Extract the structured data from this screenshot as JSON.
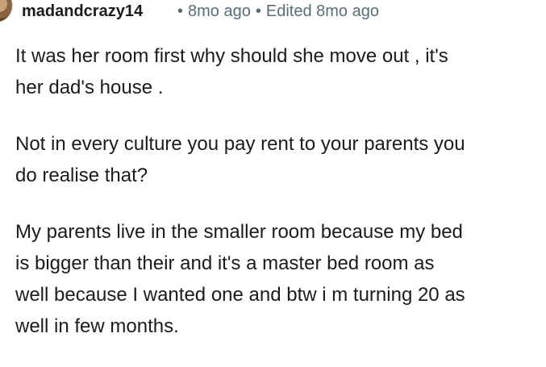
{
  "comment": {
    "username": "madandcrazy14",
    "time_ago": "8mo ago",
    "edited_label": "Edited 8mo ago",
    "paragraphs": [
      "It was her room first why should she move out , it's\nher dad's house .",
      "Not in every culture you pay rent to your parents you\ndo realise that?",
      "My parents live in the smaller room because my bed\nis bigger than their and it's a master bed room as\nwell because I wanted one and btw i m turning 20 as\nwell in few months."
    ],
    "separator": "•"
  },
  "colors": {
    "text": "#1c1c1c",
    "meta": "#576f76",
    "background": "#ffffff"
  }
}
